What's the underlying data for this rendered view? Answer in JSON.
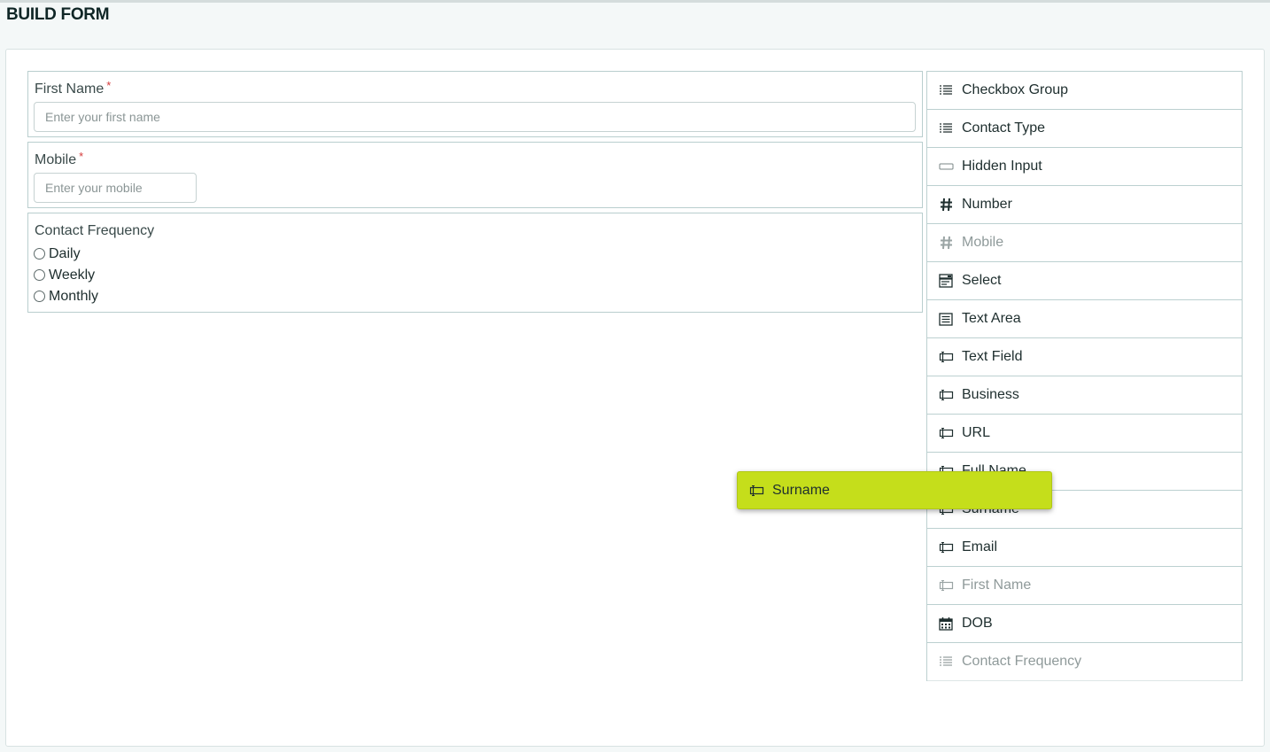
{
  "page": {
    "title": "BUILD FORM"
  },
  "form": {
    "first_name": {
      "label": "First Name",
      "required_mark": "*",
      "placeholder": "Enter your first name"
    },
    "mobile": {
      "label": "Mobile",
      "required_mark": "*",
      "placeholder": "Enter your mobile"
    },
    "contact_frequency": {
      "label": "Contact Frequency",
      "options": [
        "Daily",
        "Weekly",
        "Monthly"
      ]
    }
  },
  "palette": {
    "items": [
      {
        "label": "Checkbox Group",
        "icon": "list-icon",
        "disabled": false
      },
      {
        "label": "Contact Type",
        "icon": "list-icon",
        "disabled": false
      },
      {
        "label": "Hidden Input",
        "icon": "hidden-input-icon",
        "disabled": false
      },
      {
        "label": "Number",
        "icon": "hash-icon",
        "disabled": false
      },
      {
        "label": "Mobile",
        "icon": "hash-icon",
        "disabled": true
      },
      {
        "label": "Select",
        "icon": "select-icon",
        "disabled": false
      },
      {
        "label": "Text Area",
        "icon": "text-area-icon",
        "disabled": false
      },
      {
        "label": "Text Field",
        "icon": "text-field-icon",
        "disabled": false
      },
      {
        "label": "Business",
        "icon": "text-field-icon",
        "disabled": false
      },
      {
        "label": "URL",
        "icon": "text-field-icon",
        "disabled": false
      },
      {
        "label": "Full Name",
        "icon": "text-field-icon",
        "disabled": false
      },
      {
        "label": "Surname",
        "icon": "text-field-icon",
        "disabled": false
      },
      {
        "label": "Email",
        "icon": "text-field-icon",
        "disabled": false
      },
      {
        "label": "First Name",
        "icon": "text-field-icon",
        "disabled": true
      },
      {
        "label": "DOB",
        "icon": "calendar-icon",
        "disabled": false
      },
      {
        "label": "Contact Frequency",
        "icon": "list-icon",
        "disabled": true
      }
    ]
  },
  "drag_ghost": {
    "label": "Surname",
    "icon": "text-field-icon"
  },
  "colors": {
    "accent": "#c5de1b",
    "required": "#d43a3a",
    "border": "#b9cece"
  }
}
